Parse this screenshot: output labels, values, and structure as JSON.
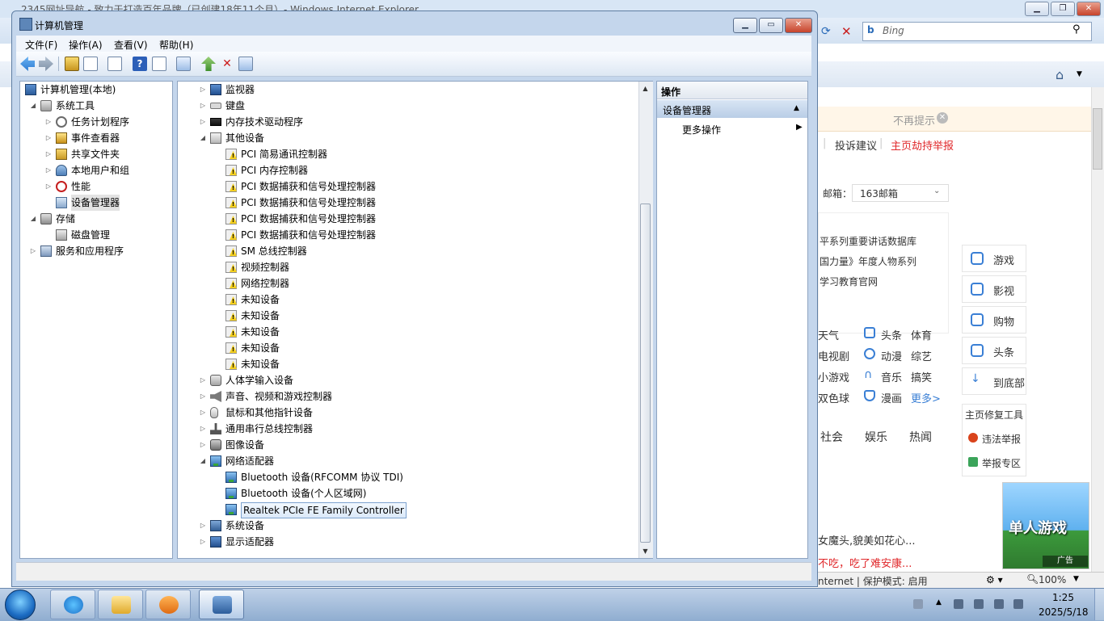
{
  "ie": {
    "title": "2345网址导航 - 致力于打造百年品牌（已创建18年11个月）- Windows Internet Explorer",
    "search_placeholder": "Bing",
    "notice": "不再提示",
    "links": [
      "投诉建议",
      "主页劫持举报"
    ],
    "mailbox_label": "邮箱：",
    "mailbox_value": "163邮箱",
    "news": [
      "平系列重要讲话数据库",
      "国力量》年度人物系列",
      "学习教育官网"
    ],
    "side_cards": [
      "游戏",
      "影视",
      "购物",
      "头条",
      "到底部"
    ],
    "grid_col1": [
      "天气",
      "电视剧",
      "小游戏",
      "双色球"
    ],
    "grid_col2": [
      "头条",
      "动漫",
      "音乐",
      "漫画"
    ],
    "grid_col3": [
      "体育",
      "综艺",
      "搞笑",
      "更多>"
    ],
    "tabs": [
      "社会",
      "娱乐",
      "热闻"
    ],
    "repair_title": "主页修复工具",
    "repair_items": [
      "违法举报",
      "举报专区"
    ],
    "story1": "女魔头,貌美如花心...",
    "story2": "不吃，吃了难安康...",
    "ad_title": "单人游戏",
    "ad_label": "广告",
    "status_zone": "nternet | 保护模式: 启用",
    "zoom": "100%"
  },
  "cm": {
    "title": "计算机管理",
    "menu": [
      "文件(F)",
      "操作(A)",
      "查看(V)",
      "帮助(H)"
    ],
    "left_tree": [
      {
        "label": "计算机管理(本地)",
        "level": 0,
        "exp": "",
        "icon": "pc"
      },
      {
        "label": "系统工具",
        "level": 1,
        "exp": "◢",
        "icon": "tools"
      },
      {
        "label": "任务计划程序",
        "level": 2,
        "exp": "▷",
        "icon": "clock"
      },
      {
        "label": "事件查看器",
        "level": 2,
        "exp": "▷",
        "icon": "event"
      },
      {
        "label": "共享文件夹",
        "level": 2,
        "exp": "▷",
        "icon": "share"
      },
      {
        "label": "本地用户和组",
        "level": 2,
        "exp": "▷",
        "icon": "users"
      },
      {
        "label": "性能",
        "level": 2,
        "exp": "▷",
        "icon": "perf"
      },
      {
        "label": "设备管理器",
        "level": 2,
        "exp": "",
        "icon": "devmgr",
        "selected": true
      },
      {
        "label": "存储",
        "level": 1,
        "exp": "◢",
        "icon": "storage"
      },
      {
        "label": "磁盘管理",
        "level": 2,
        "exp": "",
        "icon": "disk"
      },
      {
        "label": "服务和应用程序",
        "level": 1,
        "exp": "▷",
        "icon": "service"
      }
    ],
    "device_tree": [
      {
        "label": "监视器",
        "level": 0,
        "exp": "▷",
        "icon": "monitor"
      },
      {
        "label": "键盘",
        "level": 0,
        "exp": "▷",
        "icon": "keyboard"
      },
      {
        "label": "内存技术驱动程序",
        "level": 0,
        "exp": "▷",
        "icon": "memory"
      },
      {
        "label": "其他设备",
        "level": 0,
        "exp": "◢",
        "icon": "other"
      },
      {
        "label": "PCI 简易通讯控制器",
        "level": 1,
        "exp": "",
        "icon": "warn"
      },
      {
        "label": "PCI 内存控制器",
        "level": 1,
        "exp": "",
        "icon": "warn"
      },
      {
        "label": "PCI 数据捕获和信号处理控制器",
        "level": 1,
        "exp": "",
        "icon": "warn"
      },
      {
        "label": "PCI 数据捕获和信号处理控制器",
        "level": 1,
        "exp": "",
        "icon": "warn"
      },
      {
        "label": "PCI 数据捕获和信号处理控制器",
        "level": 1,
        "exp": "",
        "icon": "warn"
      },
      {
        "label": "PCI 数据捕获和信号处理控制器",
        "level": 1,
        "exp": "",
        "icon": "warn"
      },
      {
        "label": "SM 总线控制器",
        "level": 1,
        "exp": "",
        "icon": "warn"
      },
      {
        "label": "视频控制器",
        "level": 1,
        "exp": "",
        "icon": "warn"
      },
      {
        "label": "网络控制器",
        "level": 1,
        "exp": "",
        "icon": "warn"
      },
      {
        "label": "未知设备",
        "level": 1,
        "exp": "",
        "icon": "warn"
      },
      {
        "label": "未知设备",
        "level": 1,
        "exp": "",
        "icon": "warn"
      },
      {
        "label": "未知设备",
        "level": 1,
        "exp": "",
        "icon": "warn"
      },
      {
        "label": "未知设备",
        "level": 1,
        "exp": "",
        "icon": "warn"
      },
      {
        "label": "未知设备",
        "level": 1,
        "exp": "",
        "icon": "warn"
      },
      {
        "label": "人体学输入设备",
        "level": 0,
        "exp": "▷",
        "icon": "hid"
      },
      {
        "label": "声音、视频和游戏控制器",
        "level": 0,
        "exp": "▷",
        "icon": "sound"
      },
      {
        "label": "鼠标和其他指针设备",
        "level": 0,
        "exp": "▷",
        "icon": "mouse"
      },
      {
        "label": "通用串行总线控制器",
        "level": 0,
        "exp": "▷",
        "icon": "usb"
      },
      {
        "label": "图像设备",
        "level": 0,
        "exp": "▷",
        "icon": "camera"
      },
      {
        "label": "网络适配器",
        "level": 0,
        "exp": "◢",
        "icon": "net"
      },
      {
        "label": "Bluetooth 设备(RFCOMM 协议 TDI)",
        "level": 1,
        "exp": "",
        "icon": "net"
      },
      {
        "label": "Bluetooth 设备(个人区域网)",
        "level": 1,
        "exp": "",
        "icon": "net"
      },
      {
        "label": "Realtek PCIe FE Family Controller",
        "level": 1,
        "exp": "",
        "icon": "net",
        "selected": true
      },
      {
        "label": "系统设备",
        "level": 0,
        "exp": "▷",
        "icon": "sys"
      },
      {
        "label": "显示适配器",
        "level": 0,
        "exp": "▷",
        "icon": "display"
      }
    ],
    "actions": {
      "header": "操作",
      "section": "设备管理器",
      "more": "更多操作"
    }
  },
  "taskbar": {
    "time": "1:25",
    "date": "2025/5/18"
  }
}
